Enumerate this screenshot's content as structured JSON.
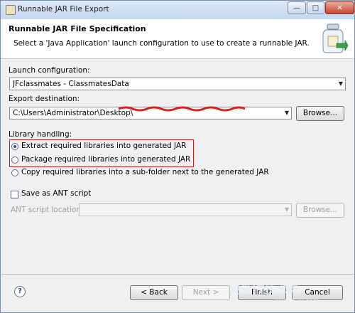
{
  "window": {
    "title": "Runnable JAR File Export",
    "minimize_glyph": "—",
    "maximize_glyph": "□",
    "close_glyph": "✕"
  },
  "banner": {
    "title": "Runnable JAR File Specification",
    "description": "Select a 'Java Application' launch configuration to use to create a runnable JAR.",
    "icon": "jar-export-icon"
  },
  "launch": {
    "label": "Launch configuration:",
    "value": "JFclassmates - ClassmatesData"
  },
  "export": {
    "label": "Export destination:",
    "value": "C:\\Users\\Administrator\\Desktop\\",
    "browse": "Browse..."
  },
  "library": {
    "label": "Library handling:",
    "options": [
      {
        "label": "Extract required libraries into generated JAR",
        "selected": true
      },
      {
        "label": "Package required libraries into generated JAR",
        "selected": false
      },
      {
        "label": "Copy required libraries into a sub-folder next to the generated JAR",
        "selected": false
      }
    ]
  },
  "ant": {
    "checkbox_label": "Save as ANT script",
    "checked": false,
    "location_label": "ANT script location:",
    "location_value": "",
    "browse": "Browse..."
  },
  "footer": {
    "help": "?",
    "back": "< Back",
    "next": "Next >",
    "finish": "Finish",
    "cancel": "Cancel"
  },
  "watermark": {
    "text": "我爱IT技术网",
    "url": "www.52ij.com"
  },
  "colors": {
    "highlight": "#c62222",
    "scribble": "#e02020"
  }
}
